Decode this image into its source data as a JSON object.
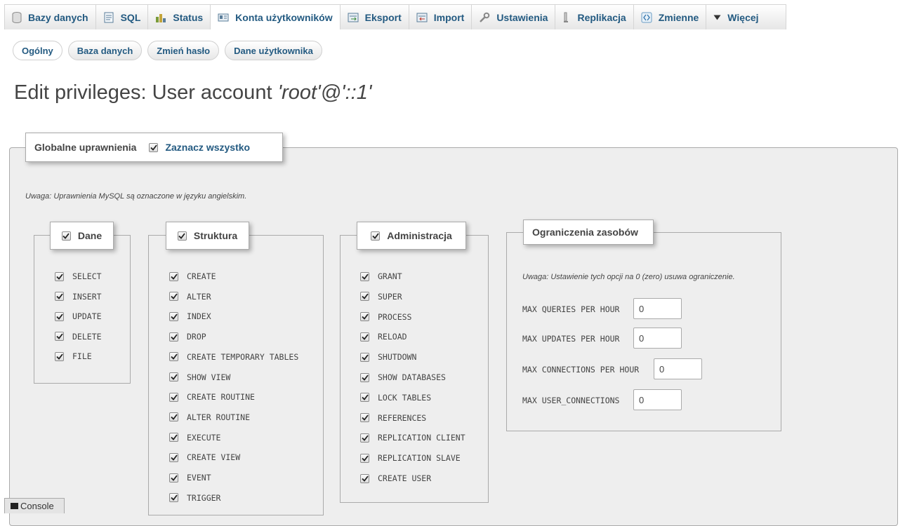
{
  "tabs": [
    {
      "label": "Bazy danych",
      "icon": "database-icon",
      "active": false
    },
    {
      "label": "SQL",
      "icon": "sql-icon",
      "active": false
    },
    {
      "label": "Status",
      "icon": "status-icon",
      "active": false
    },
    {
      "label": "Konta użytkowników",
      "icon": "user-accounts-icon",
      "active": true
    },
    {
      "label": "Eksport",
      "icon": "export-icon",
      "active": false
    },
    {
      "label": "Import",
      "icon": "import-icon",
      "active": false
    },
    {
      "label": "Ustawienia",
      "icon": "wrench-icon",
      "active": false
    },
    {
      "label": "Replikacja",
      "icon": "replication-icon",
      "active": false
    },
    {
      "label": "Zmienne",
      "icon": "variables-icon",
      "active": false
    },
    {
      "label": "Więcej",
      "icon": "triangle-down-icon",
      "active": false
    }
  ],
  "subtabs": [
    {
      "label": "Ogólny",
      "active": true
    },
    {
      "label": "Baza danych",
      "active": false
    },
    {
      "label": "Zmień hasło",
      "active": false
    },
    {
      "label": "Dane użytkownika",
      "active": false
    }
  ],
  "title": {
    "prefix": "Edit privileges: User account ",
    "account": "'root'@'::1'"
  },
  "global": {
    "legend": "Globalne uprawnienia",
    "select_all": "Zaznacz wszystko",
    "select_all_checked": true,
    "note": "Uwaga: Uprawnienia MySQL są oznaczone w języku angielskim."
  },
  "data_group": {
    "legend": "Dane",
    "checked": true,
    "items": [
      "SELECT",
      "INSERT",
      "UPDATE",
      "DELETE",
      "FILE"
    ]
  },
  "structure_group": {
    "legend": "Struktura",
    "checked": true,
    "items": [
      "CREATE",
      "ALTER",
      "INDEX",
      "DROP",
      "CREATE TEMPORARY TABLES",
      "SHOW VIEW",
      "CREATE ROUTINE",
      "ALTER ROUTINE",
      "EXECUTE",
      "CREATE VIEW",
      "EVENT",
      "TRIGGER"
    ]
  },
  "admin_group": {
    "legend": "Administracja",
    "checked": true,
    "items": [
      "GRANT",
      "SUPER",
      "PROCESS",
      "RELOAD",
      "SHUTDOWN",
      "SHOW DATABASES",
      "LOCK TABLES",
      "REFERENCES",
      "REPLICATION CLIENT",
      "REPLICATION SLAVE",
      "CREATE USER"
    ]
  },
  "resource_limits": {
    "legend": "Ograniczenia zasobów",
    "note": "Uwaga: Ustawienie tych opcji na 0 (zero) usuwa ograniczenie.",
    "limits": [
      {
        "label": "MAX QUERIES PER HOUR",
        "value": "0"
      },
      {
        "label": "MAX UPDATES PER HOUR",
        "value": "0"
      },
      {
        "label": "MAX CONNECTIONS PER HOUR",
        "value": "0"
      },
      {
        "label": "MAX USER_CONNECTIONS",
        "value": "0"
      }
    ]
  },
  "console": {
    "label": "Console"
  },
  "colors": {
    "link": "#235a81",
    "panel": "#eeeeee",
    "border": "#aaaaaa"
  }
}
